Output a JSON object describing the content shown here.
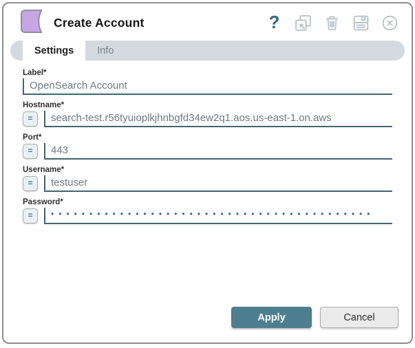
{
  "dialog": {
    "title": "Create Account"
  },
  "toolbar": {
    "help_glyph": "?",
    "icons": [
      {
        "name": "help-icon",
        "glyph": "?"
      },
      {
        "name": "open-external-icon"
      },
      {
        "name": "trash-icon"
      },
      {
        "name": "save-icon"
      },
      {
        "name": "close-icon"
      }
    ]
  },
  "tabs": [
    {
      "label": "Settings",
      "active": true
    },
    {
      "label": "Info",
      "active": false
    }
  ],
  "form": {
    "fields": [
      {
        "name": "label",
        "label": "Label*",
        "value": "OpenSearch Account",
        "flow_variable_button": false
      },
      {
        "name": "hostname",
        "label": "Hostname*",
        "value": "search-test.r56tyuioplkjhnbgfd34ew2q1.aos.us-east-1.on.aws",
        "flow_variable_button": true,
        "flow_button_glyph": "="
      },
      {
        "name": "port",
        "label": "Port*",
        "value": "443",
        "flow_variable_button": true,
        "flow_button_glyph": "="
      },
      {
        "name": "username",
        "label": "Username*",
        "value": "testuser",
        "flow_variable_button": true,
        "flow_button_glyph": "="
      },
      {
        "name": "password",
        "label": "Password*",
        "value": "••••••••••••••••••••••••••••••••••••••••••",
        "masked": true,
        "flow_variable_button": true,
        "flow_button_glyph": "="
      }
    ]
  },
  "footer": {
    "apply_label": "Apply",
    "cancel_label": "Cancel"
  },
  "colors": {
    "accent_teal": "#4E7F91",
    "toolbar_icon_gray": "#B9C4CB",
    "help_teal": "#2F6880",
    "node_icon_purple": "#C8A5E5",
    "tab_bar_gray": "#D4DBE0",
    "input_border": "#44626F",
    "input_text": "#6E7A83"
  }
}
